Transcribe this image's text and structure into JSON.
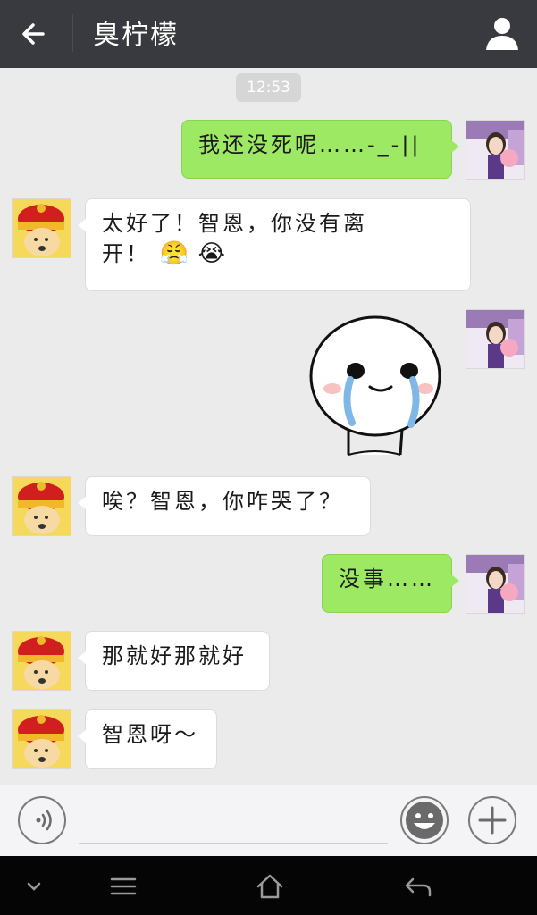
{
  "header": {
    "title": "臭柠檬",
    "back_icon": "arrow-left-icon",
    "profile_icon": "person-icon"
  },
  "chat": {
    "timestamp": "12:53",
    "messages": [
      {
        "side": "right",
        "text": "我还没死呢……-_-||"
      },
      {
        "side": "left",
        "text_line1": "太好了！智恩，你没有离",
        "text_line2": "开！",
        "emojis": [
          "😤",
          "😭"
        ]
      },
      {
        "side": "right",
        "type": "sticker",
        "sticker": "crying-face-sticker"
      },
      {
        "side": "left",
        "text": "唉？智恩，你咋哭了？"
      },
      {
        "side": "right",
        "text": "没事……"
      },
      {
        "side": "left",
        "text": "那就好那就好"
      },
      {
        "side": "left",
        "text": "智恩呀～"
      }
    ]
  },
  "input_bar": {
    "voice_icon": "voice-icon",
    "emoji_icon": "smiley-icon",
    "plus_icon": "plus-icon"
  },
  "nav_bar": {
    "icons": [
      "chevron-down-icon",
      "menu-icon",
      "home-icon",
      "back-icon"
    ]
  },
  "colors": {
    "header_bg": "#393a3f",
    "chat_bg": "#ebebeb",
    "sent_bubble": "#9ee964",
    "received_bubble": "#ffffff"
  }
}
